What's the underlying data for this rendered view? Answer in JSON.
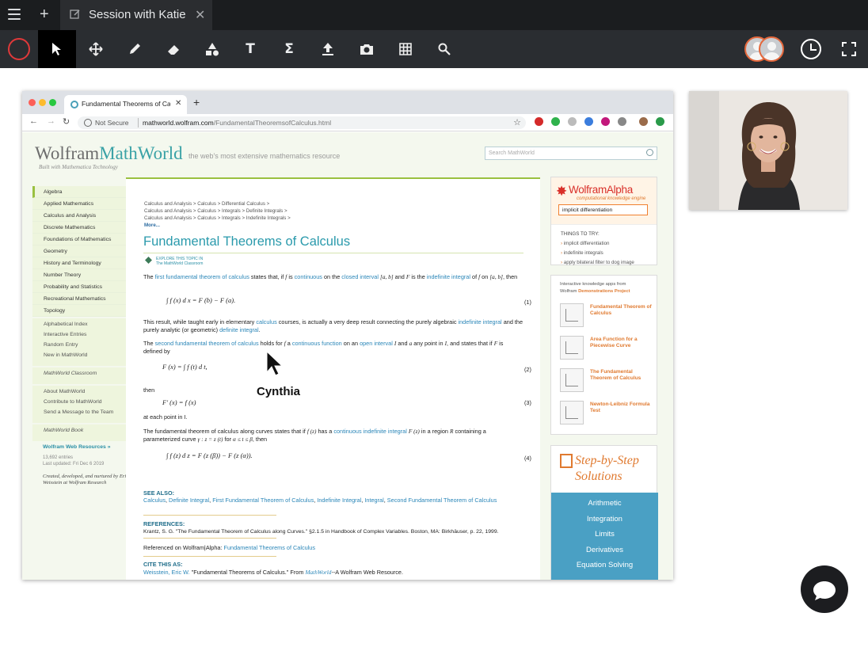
{
  "topbar": {
    "session_title": "Session with Katie",
    "new_tab_label": "+",
    "close_label": "✕"
  },
  "toolbar": {
    "tools": [
      "record",
      "select",
      "move",
      "pen",
      "eraser",
      "shapes",
      "text",
      "equation",
      "upload",
      "camera",
      "grid",
      "search"
    ],
    "text_tool_glyph": "T",
    "equation_tool_glyph": "Σ",
    "participants": 2,
    "record_color": "#e0393a"
  },
  "browser": {
    "tab_title": "Fundamental Theorems of Calculus",
    "not_secure": "Not Secure",
    "url_domain": "mathworld.wolfram.com",
    "url_path": "/FundamentalTheoremsofCalculus.html"
  },
  "mathworld": {
    "logo_a": "Wolfram",
    "logo_b": "MathWorld",
    "logo_sub": "Built with Mathematica Technology",
    "tagline": "the web's most extensive mathematics resource",
    "search_placeholder": "Search MathWorld",
    "categories": [
      "Algebra",
      "Applied Mathematics",
      "Calculus and Analysis",
      "Discrete Mathematics",
      "Foundations of Mathematics",
      "Geometry",
      "History and Terminology",
      "Number Theory",
      "Probability and Statistics",
      "Recreational Mathematics",
      "Topology"
    ],
    "links1": [
      "Alphabetical Index",
      "Interactive Entries",
      "Random Entry",
      "New in MathWorld"
    ],
    "links2": [
      "MathWorld Classroom"
    ],
    "links3": [
      "About MathWorld",
      "Contribute to MathWorld",
      "Send a Message to the Team"
    ],
    "links4": [
      "MathWorld Book"
    ],
    "resources_title": "Wolfram Web Resources »",
    "entries": "13,692 entries",
    "updated": "Last updated: Fri Dec 6 2019",
    "credit": "Created, developed, and nurtured by Eric Weisstein at Wolfram Research"
  },
  "article": {
    "breadcrumbs": [
      "Calculus and Analysis > Calculus > Differential Calculus >",
      "Calculus and Analysis > Calculus > Integrals > Definite Integrals >",
      "Calculus and Analysis > Calculus > Integrals > Indefinite Integrals >"
    ],
    "more": "More...",
    "title": "Fundamental Theorems of Calculus",
    "explore": "EXPLORE THIS TOPIC IN",
    "explore2": "The MathWorld Classroom",
    "eq1": "∫ f (x) d x = F (b) − F (a).",
    "eq2": "F (x) = ∫ f (t) d t,",
    "eq3": "F′ (x) = f (x)",
    "eq4": "∫ f (z) d z = F (z (β)) − F (z (α)).",
    "eq_nums": [
      "(1)",
      "(2)",
      "(3)",
      "(4)"
    ],
    "then": "then",
    "at_each": "at each point in I.",
    "see_also": "SEE ALSO:",
    "references": "REFERENCES:",
    "ref_text": "Krantz, S. G. \"The Fundamental Theorem of Calculus along Curves.\" §2.1.5 in Handbook of Complex Variables. Boston, MA: Birkhäuser, p. 22, 1999.",
    "referenced_on": "Referenced on Wolfram|Alpha: ",
    "referenced_link": "Fundamental Theorems of Calculus",
    "cite": "CITE THIS AS:"
  },
  "wolframalpha": {
    "name": "WolframAlpha",
    "sub": "computational knowledge engine",
    "input": "implicit differentiation",
    "things": "THINGS TO TRY:",
    "suggestions": [
      "implicit differentiation",
      "indefinite integrals",
      "apply bilateral filter to dog image"
    ]
  },
  "demos": {
    "header": "Interactive knowledge apps from",
    "wolfram": "Wolfram",
    "project": "Demonstrations Project",
    "apps": [
      "Fundamental Theorem of Calculus",
      "Area Function for a Piecewise Curve",
      "The Fundamental Theorem of Calculus",
      "Newton-Leibniz Formula Test"
    ]
  },
  "stepbystep": {
    "title1": "Step-by-Step",
    "title2": "Solutions",
    "items": [
      "Arithmetic",
      "Integration",
      "Limits",
      "Derivatives",
      "Equation Solving"
    ]
  },
  "cursor": {
    "label": "Cynthia"
  },
  "colors": {
    "accent": "#2a9aac",
    "link": "#2a86b8",
    "orange": "#e07a30",
    "red": "#d9302a"
  }
}
